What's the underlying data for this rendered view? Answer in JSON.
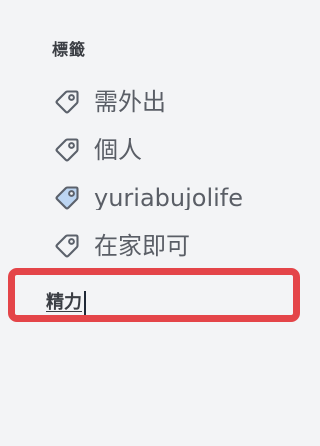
{
  "section": {
    "title": "標籤"
  },
  "tags": [
    {
      "label": "需外出",
      "icon": "tag-icon",
      "icon_color": "#5b616b",
      "fill": "none"
    },
    {
      "label": "個人",
      "icon": "tag-icon",
      "icon_color": "#5b616b",
      "fill": "none"
    },
    {
      "label": "yuriabujolife",
      "icon": "tag-icon",
      "icon_color": "#5b616b",
      "fill": "#bcd5f2"
    },
    {
      "label": "在家即可",
      "icon": "tag-icon",
      "icon_color": "#5b616b",
      "fill": "none"
    }
  ],
  "new_tag": {
    "value": "精力",
    "highlight_color": "#e44549"
  }
}
